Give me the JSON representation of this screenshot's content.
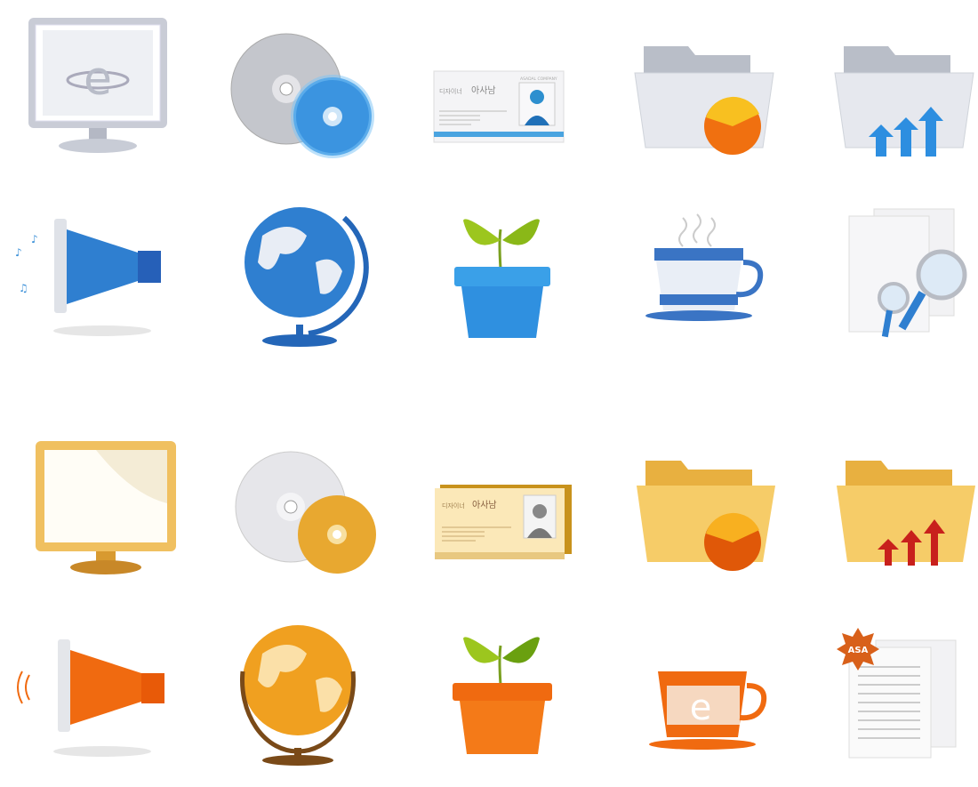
{
  "icon_set": {
    "blue_theme": {
      "monitor_letter": "e",
      "card": {
        "name_prefix": "디자이너",
        "name": "아사남",
        "company": "ASADAL COMPANY"
      }
    },
    "orange_theme": {
      "card": {
        "name_prefix": "디자이너",
        "name": "아사남"
      },
      "cup_letter": "e",
      "badge": "ASA"
    }
  },
  "colors": {
    "blue": "#2f7fd0",
    "orange": "#f06a10",
    "gold": "#e8b040",
    "green": "#8cbc1c"
  }
}
